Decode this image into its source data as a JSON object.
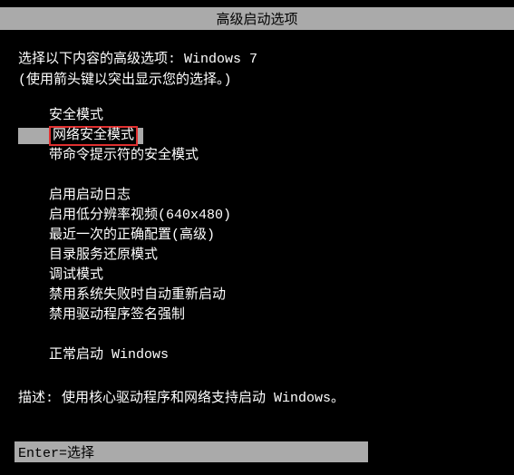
{
  "title": "高级启动选项",
  "instruction_prefix": "选择以下内容的高级选项: ",
  "os_name": "Windows 7",
  "hint": "(使用箭头键以突出显示您的选择。)",
  "group1": {
    "opt0": "安全模式",
    "opt1": "网络安全模式",
    "opt2": "带命令提示符的安全模式"
  },
  "group2": {
    "opt0": "启用启动日志",
    "opt1": "启用低分辨率视频(640x480)",
    "opt2": "最近一次的正确配置(高级)",
    "opt3": "目录服务还原模式",
    "opt4": "调试模式",
    "opt5": "禁用系统失败时自动重新启动",
    "opt6": "禁用驱动程序签名强制"
  },
  "group3": {
    "opt0": "正常启动 Windows"
  },
  "selected_option": "网络安全模式",
  "description_label": "描述: ",
  "description_text": "使用核心驱动程序和网络支持启动 Windows。",
  "bottom_bar": "Enter=选择"
}
